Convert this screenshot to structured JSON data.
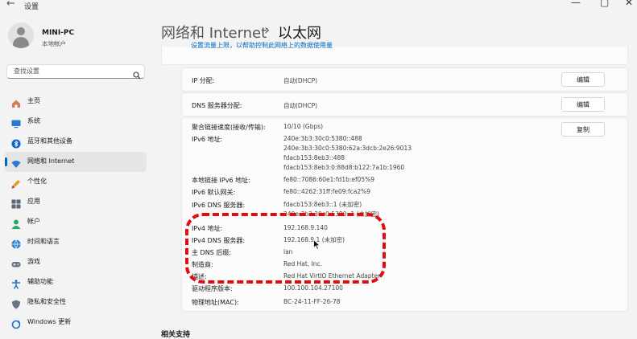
{
  "window": {
    "title": "设置",
    "back": "←",
    "minimize": "—",
    "maximize": "▢",
    "close": "✕"
  },
  "profile": {
    "name": "MINI-PC",
    "account": "本地帐户"
  },
  "search": {
    "placeholder": "查找设置"
  },
  "nav": {
    "items": [
      {
        "label": "主页",
        "icon": "home-icon"
      },
      {
        "label": "系统",
        "icon": "monitor-icon"
      },
      {
        "label": "蓝牙和其他设备",
        "icon": "bluetooth-icon"
      },
      {
        "label": "网络和 Internet",
        "icon": "wifi-icon",
        "active": true
      },
      {
        "label": "个性化",
        "icon": "brush-icon"
      },
      {
        "label": "应用",
        "icon": "apps-icon"
      },
      {
        "label": "帐户",
        "icon": "person-icon"
      },
      {
        "label": "时间和语言",
        "icon": "globe-clock-icon"
      },
      {
        "label": "游戏",
        "icon": "gamepad-icon"
      },
      {
        "label": "辅助功能",
        "icon": "accessibility-icon"
      },
      {
        "label": "隐私和安全性",
        "icon": "shield-icon"
      },
      {
        "label": "Windows 更新",
        "icon": "update-icon"
      }
    ]
  },
  "breadcrumb": {
    "parent": "网络和 Internet",
    "separator": "›",
    "current": "以太网"
  },
  "top_link": "设置流量上限，以帮助控制此网络上的数据使用量",
  "ip_assignment": {
    "label": "IP 分配:",
    "value": "自动(DHCP)",
    "button": "编辑"
  },
  "dns_assignment": {
    "label": "DNS 服务器分配:",
    "value": "自动(DHCP)",
    "button": "编辑"
  },
  "details": {
    "copy_button": "复制",
    "rows": [
      {
        "label": "聚合链接速度(接收/传输):",
        "values": [
          "10/10 (Gbps)"
        ]
      },
      {
        "label": "IPv6 地址:",
        "values": [
          "240e:3b3:30c0:5380::488",
          "240e:3b3:30c0:5380:62a:3dcb:2e26:9013",
          "fdacb153:8eb3::488",
          "fdacb153:8eb3:0:88d8:b122:7a1b:1960"
        ]
      },
      {
        "label": "本地链接 IPv6 地址:",
        "values": [
          "fe80::7086:60e1:fd1b:ef05%9"
        ]
      },
      {
        "label": "IPv6 默认网关:",
        "values": [
          "fe80::4262:31ff:fe09:fca2%9"
        ]
      },
      {
        "label": "IPv6 DNS 服务器:",
        "values": [
          "fdacb153:8eb3::1 (未加密)",
          "240e:3b3:30c0:5380::1 (未加密)"
        ]
      },
      {
        "label": "IPv4 地址:",
        "values": [
          "192.168.9.140"
        ]
      },
      {
        "label": "IPv4 DNS 服务器:",
        "values": [
          "192.168.9.1 (未加密)"
        ]
      },
      {
        "label": "主 DNS 后缀:",
        "values": [
          "lan"
        ]
      },
      {
        "label": "制造商:",
        "values": [
          "Red Hat, Inc."
        ]
      },
      {
        "label": "描述:",
        "values": [
          "Red Hat VirtIO Ethernet Adapter"
        ]
      },
      {
        "label": "驱动程序版本:",
        "values": [
          "100.100.104.27100"
        ]
      },
      {
        "label": "物理地址(MAC):",
        "values": [
          "BC-24-11-FF-26-78"
        ]
      }
    ]
  },
  "related": "相关支持",
  "colors": {
    "accent": "#0067c0",
    "annotation": "#e00d10"
  }
}
